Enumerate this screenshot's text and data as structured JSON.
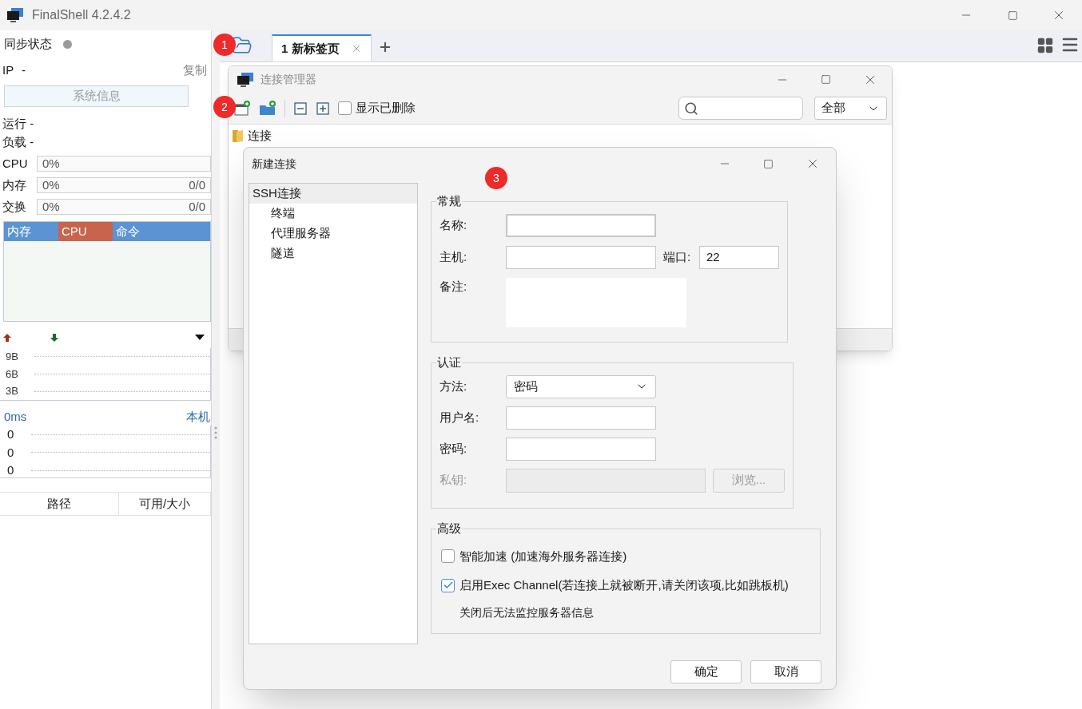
{
  "window": {
    "title": "FinalShell 4.2.4.2"
  },
  "sidebar": {
    "sync_label": "同步状态",
    "sync_connected": false,
    "ip_label": "IP",
    "ip_value": "-",
    "copy_link": "复制",
    "sysinfo_button": "系统信息",
    "uptime": "运行 -",
    "load": "负载 -",
    "meters": [
      {
        "label": "CPU",
        "reading": "0%",
        "level": 0
      },
      {
        "label": "内存",
        "reading": "0%",
        "extra": "0/0",
        "level": 0
      },
      {
        "label": "交换",
        "reading": "0%",
        "extra": "0/0",
        "level": 0
      }
    ],
    "process_tabs": [
      {
        "label": "内存",
        "selected": false
      },
      {
        "label": "CPU",
        "selected": true
      },
      {
        "label": "命令",
        "selected": false
      }
    ],
    "network_scale": [
      "9B",
      "6B",
      "3B"
    ],
    "latency": {
      "value": "0ms",
      "host": "本机",
      "scale": [
        "0",
        "0",
        "0"
      ]
    },
    "file_columns": [
      "路径",
      "可用/大小"
    ]
  },
  "tabs": [
    {
      "label": "1 新标签页",
      "selected": true
    }
  ],
  "connection_manager": {
    "title": "连接管理器",
    "show_deleted": {
      "label": "显示已删除",
      "checked": false
    },
    "filter": "全部",
    "tree": [
      {
        "label": "连接"
      }
    ]
  },
  "new_connection": {
    "title": "新建连接",
    "nav": [
      {
        "label": "SSH连接",
        "selected": true,
        "children": [
          {
            "label": "终端",
            "selected": false
          },
          {
            "label": "代理服务器",
            "selected": false
          },
          {
            "label": "隧道",
            "selected": false
          }
        ]
      }
    ],
    "general": {
      "title": "常规",
      "name_label": "名称:",
      "name_focused": true,
      "host_label": "主机:",
      "port_label": "端口:",
      "port_value": "22",
      "note_label": "备注:"
    },
    "auth": {
      "title": "认证",
      "method_label": "方法:",
      "method_value": "密码",
      "user_label": "用户名:",
      "password_label": "密码:",
      "key": {
        "label": "私钥:",
        "disabled": true,
        "button": "浏览..."
      }
    },
    "advanced": {
      "title": "高级",
      "options": [
        {
          "label": "智能加速 (加速海外服务器连接)",
          "checked": false
        },
        {
          "label": "启用Exec Channel(若连接上就被断开,请关闭该项,比如跳板机)",
          "checked": true,
          "note": "关闭后无法监控服务器信息"
        }
      ]
    },
    "buttons": [
      "确定",
      "取消"
    ]
  },
  "annotations": [
    "1",
    "2",
    "3"
  ]
}
